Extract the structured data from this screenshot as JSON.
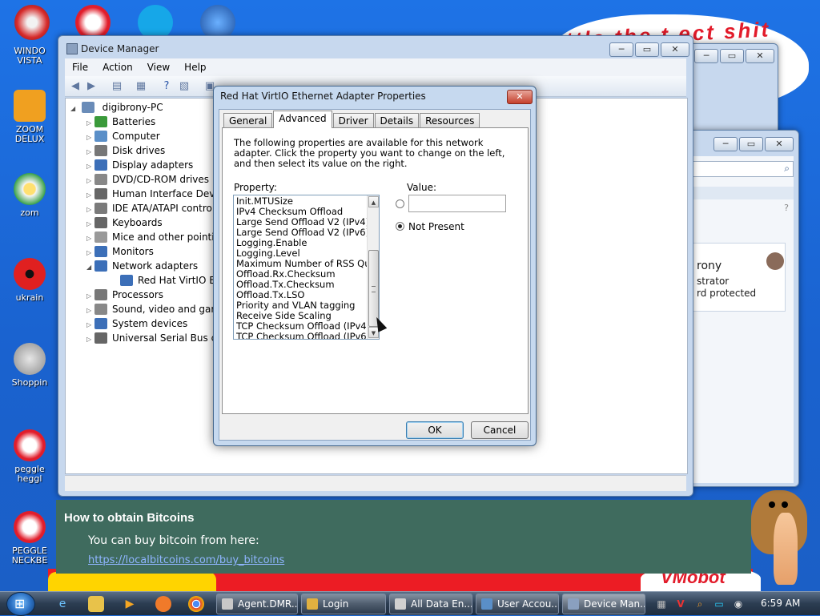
{
  "desktop": {
    "scrawl_top": "ttle the t ect shit",
    "scrawl_bottom": "VMobot",
    "icons": [
      {
        "label": "WINDO\nVISTA"
      },
      {
        "label": "ZOOM\nDELUX"
      },
      {
        "label": "zom"
      },
      {
        "label": "ukrain"
      },
      {
        "label": "Shoppin"
      },
      {
        "label": "peggle\nheggl"
      },
      {
        "label": "PEGGLE\nNECKBE"
      }
    ]
  },
  "device_manager": {
    "title": "Device Manager",
    "menu": [
      "File",
      "Action",
      "View",
      "Help"
    ],
    "root": "digibrony-PC",
    "tree": [
      {
        "label": "Batteries",
        "color": "#3a9a3a"
      },
      {
        "label": "Computer",
        "color": "#5a8fc8"
      },
      {
        "label": "Disk drives",
        "color": "#777777"
      },
      {
        "label": "Display adapters",
        "color": "#3c6fb8"
      },
      {
        "label": "DVD/CD-ROM drives",
        "color": "#888888"
      },
      {
        "label": "Human Interface Device",
        "color": "#666666"
      },
      {
        "label": "IDE ATA/ATAPI control",
        "color": "#7a7a7a"
      },
      {
        "label": "Keyboards",
        "color": "#666666"
      },
      {
        "label": "Mice and other pointing",
        "color": "#999999"
      },
      {
        "label": "Monitors",
        "color": "#3c6fb8"
      },
      {
        "label": "Network adapters",
        "color": "#3c6fb8"
      },
      {
        "label": "Red Hat VirtIO Ethern",
        "color": "#3c6fb8",
        "child": true
      },
      {
        "label": "Processors",
        "color": "#777777"
      },
      {
        "label": "Sound, video and game",
        "color": "#888888"
      },
      {
        "label": "System devices",
        "color": "#3c6fb8"
      },
      {
        "label": "Universal Serial Bus con",
        "color": "#666666"
      }
    ]
  },
  "side_window": {
    "user_name": "rony",
    "user_role": "strator",
    "user_status": "rd protected"
  },
  "bitcoin_panel": {
    "heading": "How to obtain Bitcoins",
    "text": "You can buy bitcoin from here:",
    "link": "https://localbitcoins.com/buy_bitcoins"
  },
  "dialog": {
    "title": "Red Hat VirtIO Ethernet Adapter Properties",
    "close_label": "✕",
    "tabs": [
      "General",
      "Advanced",
      "Driver",
      "Details",
      "Resources"
    ],
    "active_tab": "Advanced",
    "description": "The following properties are available for this network adapter. Click the property you want to change on the left, and then select its value on the right.",
    "property_label": "Property:",
    "value_label": "Value:",
    "properties": [
      "Init.MTUSize",
      "IPv4 Checksum Offload",
      "Large Send Offload V2 (IPv4)",
      "Large Send Offload V2 (IPv6)",
      "Logging.Enable",
      "Logging.Level",
      "Maximum Number of RSS Queues",
      "Offload.Rx.Checksum",
      "Offload.Tx.Checksum",
      "Offload.Tx.LSO",
      "Priority and VLAN tagging",
      "Receive Side Scaling",
      "TCP Checksum Offload (IPv4)",
      "TCP Checksum Offload (IPv6)"
    ],
    "value_input": "",
    "not_present_label": "Not Present",
    "ok_label": "OK",
    "cancel_label": "Cancel"
  },
  "taskbar": {
    "tasks": [
      "Agent.DMR...",
      "Login",
      "All Data En...",
      "User Accou...",
      "Device Man..."
    ],
    "active_task": "Device Man...",
    "clock": "6:59 AM"
  }
}
